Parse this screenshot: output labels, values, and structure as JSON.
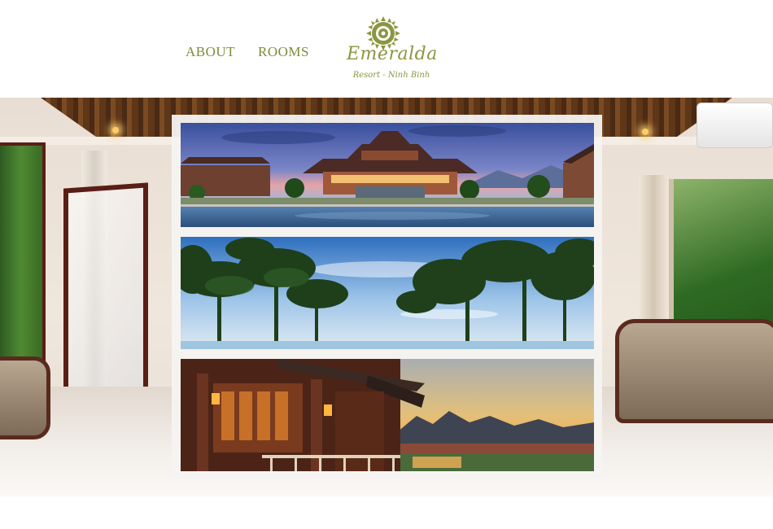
{
  "nav": {
    "about_label": "ABOUT",
    "rooms_label": "ROOMS"
  },
  "logo": {
    "name": "Emeralda",
    "subtitle": "Resort - Ninh Binh",
    "icon": "lotus-flower-icon",
    "color": "#8c9640"
  },
  "colors": {
    "nav_link": "#7e8a3a",
    "panel_background": "#f5f3f1"
  },
  "gallery": {
    "photos": [
      {
        "subject": "resort-main-building-pagoda-at-dusk"
      },
      {
        "subject": "palm-trees-and-blue-sky"
      },
      {
        "subject": "wooden-pavilion-with-mountain-sunset"
      }
    ]
  }
}
